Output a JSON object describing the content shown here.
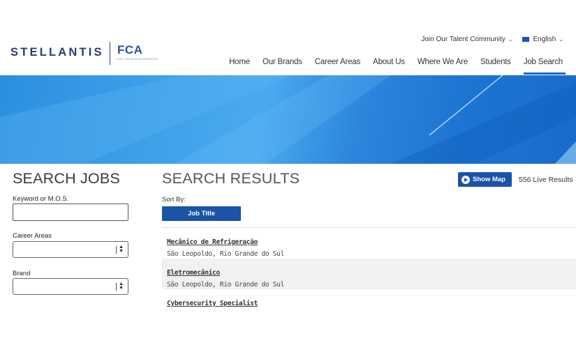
{
  "header": {
    "brand": "STELLANTIS",
    "sub_brand": "FCA",
    "sub_brand_tagline": "FIAT CHRYSLER AUTOMOBILES",
    "top_links": {
      "talent_community": "Join Our Talent Community",
      "language": "English"
    },
    "nav": [
      "Home",
      "Our Brands",
      "Career Areas",
      "About Us",
      "Where We Are",
      "Students",
      "Job Search"
    ],
    "active_nav": "Job Search"
  },
  "colors": {
    "brand_navy": "#2d3a73",
    "accent_blue": "#1a53a8",
    "nav_underline": "#1a64c8"
  },
  "search_panel": {
    "title": "SEARCH JOBS",
    "keyword_label": "Keyword or M.O.S.",
    "keyword_value": "",
    "career_areas_label": "Career Areas",
    "career_areas_value": "",
    "brand_label": "Brand",
    "brand_value": ""
  },
  "results": {
    "title": "SEARCH RESULTS",
    "show_map_label": "Show Map",
    "live_results": "556 Live Results",
    "sort_by_label": "Sort By:",
    "sort_button": "Job Title",
    "items": [
      {
        "title": "Mecânico de Refrigeração",
        "location": "São Leopoldo, Rio Grande do Sul"
      },
      {
        "title": "Eletromecânico",
        "location": "São Leopoldo, Rio Grande do Sul"
      },
      {
        "title": "Cybersecurity Specialist",
        "location": ""
      }
    ]
  },
  "icons": {
    "map": "play-circle-icon",
    "chevron": "chevron-down-icon",
    "flag": "flag-icon",
    "select": "select-arrows-icon"
  }
}
